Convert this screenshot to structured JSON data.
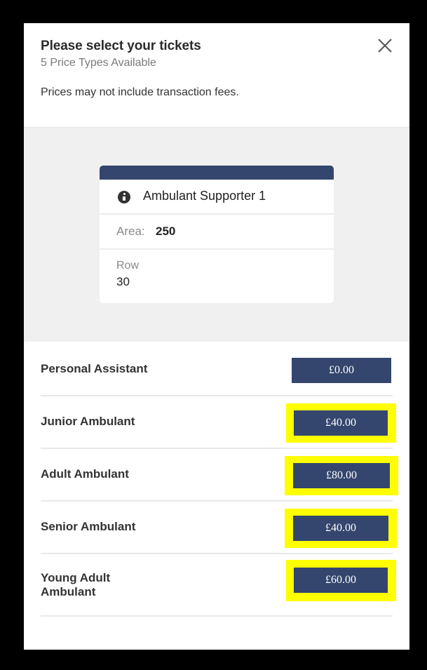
{
  "modal": {
    "title": "Please select your tickets",
    "subtitle": "5 Price Types Available",
    "notice": "Prices may not include transaction fees.",
    "close_icon": "close-x-icon"
  },
  "seat": {
    "icon": "info-icon",
    "name": "Ambulant Supporter 1",
    "area_label": "Area:",
    "area_value": "250",
    "row_label": "Row",
    "row_value": "30"
  },
  "prices": [
    {
      "name": "Personal Assistant",
      "price": "£0.00",
      "highlighted": false
    },
    {
      "name": "Junior Ambulant",
      "price": "£40.00",
      "highlighted": true
    },
    {
      "name": "Adult Ambulant",
      "price": "£80.00",
      "highlighted": true
    },
    {
      "name": "Senior Ambulant",
      "price": "£40.00",
      "highlighted": true
    },
    {
      "name": "Young Adult Ambulant",
      "price": "£60.00",
      "highlighted": true
    }
  ],
  "colors": {
    "accent": "#34466e",
    "highlight": "#ffff00",
    "frame": "#000000"
  }
}
